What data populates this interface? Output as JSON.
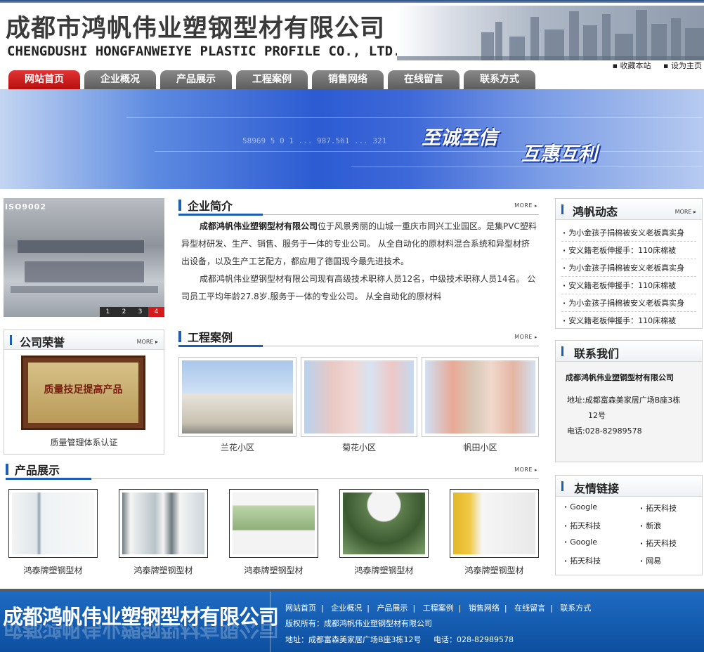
{
  "header": {
    "logo_cn": "成都市鸿帆伟业塑钢型材有限公司",
    "logo_en": "CHENGDUSHI HONGFANWEIYE PLASTIC PROFILE CO., LTD.",
    "links": [
      "收藏本站",
      "设为主页"
    ]
  },
  "nav": {
    "tabs": [
      {
        "label": "网站首页",
        "active": true
      },
      {
        "label": "企业概况"
      },
      {
        "label": "产品展示"
      },
      {
        "label": "工程案例"
      },
      {
        "label": "销售网络"
      },
      {
        "label": "在线留言"
      },
      {
        "label": "联系方式"
      }
    ]
  },
  "banner": {
    "slogan1": "至诚至信",
    "slogan2": "互惠互利",
    "numbers": "58969 5 0 1 ... 987.561 ... 321"
  },
  "slider": {
    "label": "ISO9002",
    "pages": [
      "1",
      "2",
      "3",
      "4"
    ],
    "active_page": "4"
  },
  "intro": {
    "title": "企业简介",
    "more": "MORE",
    "company_bold": "成都鸿帆伟业塑钢型材有限公司",
    "p1": "位于风景秀丽的山城一重庆市同兴工业园区。是集PVC塑料异型材研发、生产、销售、服务于一体的专业公司。 从全自动化的原材料混合系统和异型材挤出设备，以及生产工艺配方，都应用了德国现今最先进技术。",
    "p2": "成都鸿帆伟业塑钢型材有限公司现有高级技术职称人员12名，中级技术职称人员14名。 公司员工平均年龄27.8岁.服务于一体的专业公司。 从全自动化的原材料"
  },
  "honor": {
    "title": "公司荣誉",
    "more": "MORE",
    "plaque_text": "质量技足提高产品",
    "caption": "质量管理体系认证"
  },
  "cases": {
    "title": "工程案例",
    "more": "MORE",
    "items": [
      "兰花小区",
      "菊花小区",
      "帆田小区"
    ]
  },
  "products": {
    "title": "产品展示",
    "more": "MORE",
    "items": [
      "鸿泰牌塑钢型材",
      "鸿泰牌塑钢型材",
      "鸿泰牌塑钢型材",
      "鸿泰牌塑钢型材",
      "鸿泰牌塑钢型材"
    ]
  },
  "news": {
    "title": "鸿帆动态",
    "more": "MORE",
    "items": [
      "为小金孩子捐棉被安义老板真实身",
      "安义籍老板伸援手：110床棉被",
      "为小金孩子捐棉被安义老板真实身",
      "安义籍老板伸援手：110床棉被",
      "为小金孩子捐棉被安义老板真实身",
      "安义籍老板伸援手：110床棉被"
    ]
  },
  "contact": {
    "title": "联系我们",
    "company": "成都鸿帆伟业塑钢型材有限公司",
    "address_label": "地址:",
    "address_1": "成都富森美家居广场B座3栋",
    "address_2": "12号",
    "phone": "电话:028-82989578"
  },
  "links": {
    "title": "友情链接",
    "items": [
      "Google",
      "拓天科技",
      "拓天科技",
      "新浪",
      "Google",
      "拓天科技",
      "拓天科技",
      "网易"
    ]
  },
  "footer": {
    "logo": "成都鸿帆伟业塑钢型材有限公司",
    "nav": [
      "网站首页",
      "企业概况",
      "产品展示",
      "工程案例",
      "销售网络",
      "在线留言",
      "联系方式"
    ],
    "copyright": "版权所有：成都鸿帆伟业塑钢型材有限公司",
    "address": "地址：成都富森美家居广场B座3栋12号",
    "phone": "电话：028-82989578"
  }
}
